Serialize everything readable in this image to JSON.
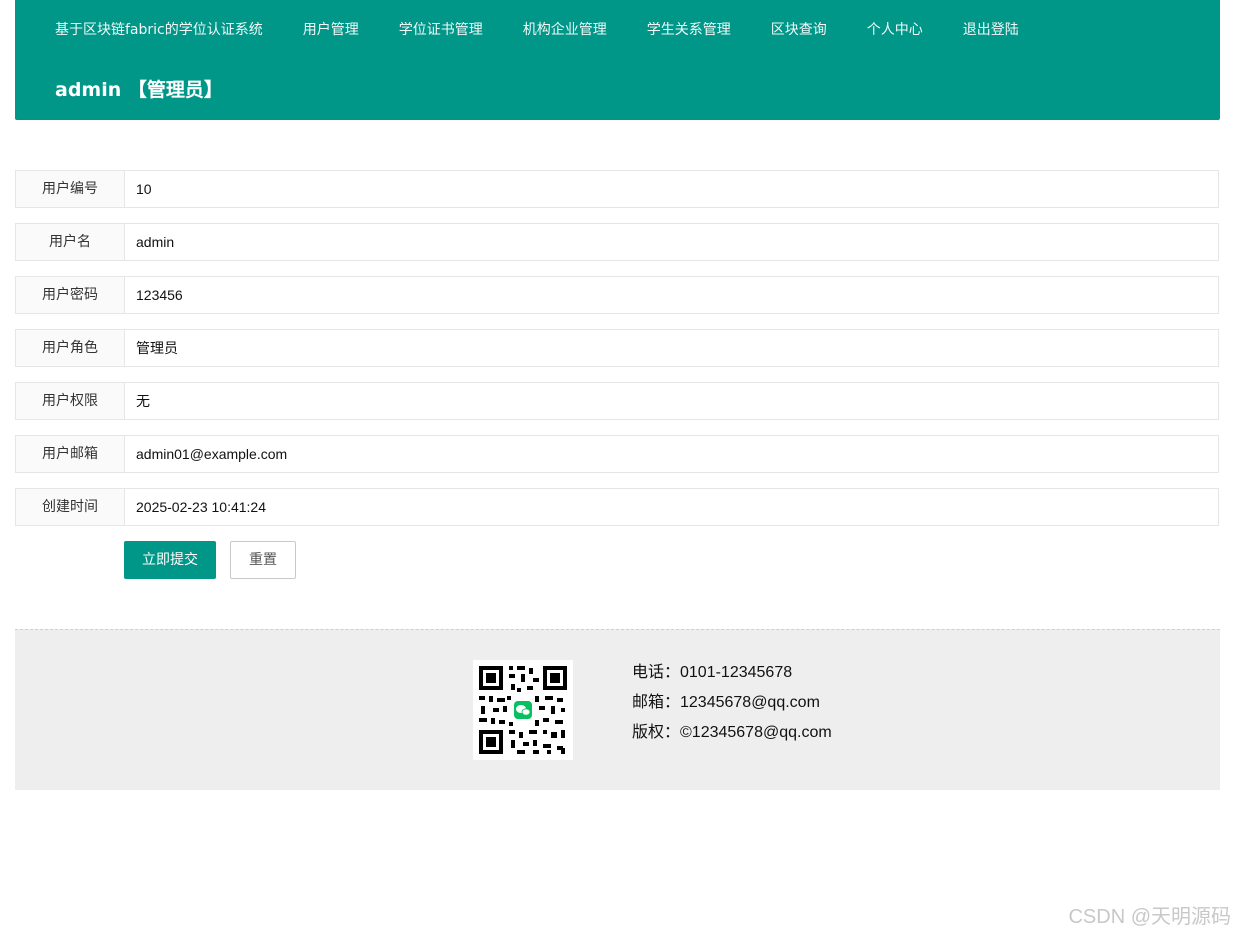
{
  "nav": {
    "items": [
      {
        "label": "基于区块链fabric的学位认证系统"
      },
      {
        "label": "用户管理"
      },
      {
        "label": "学位证书管理"
      },
      {
        "label": "机构企业管理"
      },
      {
        "label": "学生关系管理"
      },
      {
        "label": "区块查询"
      },
      {
        "label": "个人中心"
      },
      {
        "label": "退出登陆"
      }
    ]
  },
  "user": {
    "display": "admin 【管理员】"
  },
  "form": {
    "fields": [
      {
        "label": "用户编号",
        "value": "10"
      },
      {
        "label": "用户名",
        "value": "admin"
      },
      {
        "label": "用户密码",
        "value": "123456"
      },
      {
        "label": "用户角色",
        "value": "管理员"
      },
      {
        "label": "用户权限",
        "value": "无"
      },
      {
        "label": "用户邮箱",
        "value": "admin01@example.com"
      },
      {
        "label": "创建时间",
        "value": "2025-02-23 10:41:24"
      }
    ],
    "submit_label": "立即提交",
    "reset_label": "重置"
  },
  "footer": {
    "phone": "电话：0101-12345678",
    "email": "邮箱：12345678@qq.com",
    "copyright": "版权：©12345678@qq.com",
    "qr_icon": "wechat-qr-code"
  },
  "watermark": "CSDN @天明源码",
  "colors": {
    "primary": "#009688",
    "footer_bg": "#eeeeee"
  }
}
